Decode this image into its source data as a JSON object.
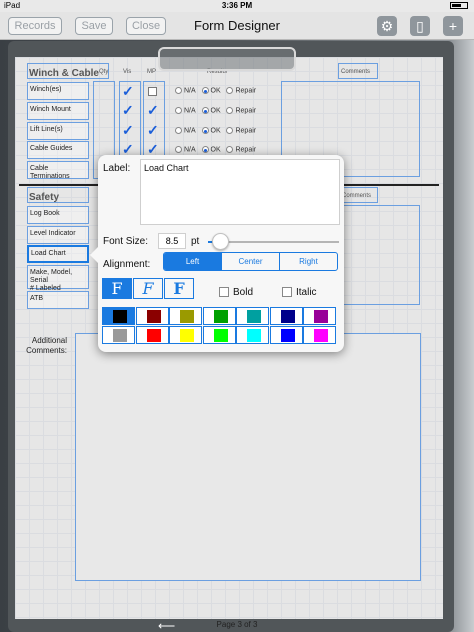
{
  "status_bar": {
    "device": "iPad",
    "time": "3:36 PM"
  },
  "toolbar": {
    "records_label": "Records",
    "save_label": "Save",
    "close_label": "Close",
    "title": "Form Designer"
  },
  "form": {
    "section1_title": "Winch & Cable",
    "col_headers": [
      "Qty",
      "Vis",
      "MP",
      "Results",
      "Comments"
    ],
    "rows": [
      {
        "label": "Winch(es)",
        "vis": true,
        "mp": false,
        "result": "OK"
      },
      {
        "label": "Winch Mount",
        "vis": true,
        "mp": true,
        "result": "OK"
      },
      {
        "label": "Lift Line(s)",
        "vis": true,
        "mp": true,
        "result": "OK"
      },
      {
        "label": "Cable Guides",
        "vis": true,
        "mp": true,
        "result": "OK"
      },
      {
        "label": "Cable Terminations",
        "vis": true,
        "mp": false,
        "result": ""
      }
    ],
    "radio_labels": [
      "N/A",
      "OK",
      "Repair"
    ],
    "section2_title": "Safety",
    "section2_comments_header": "Comments",
    "safety_rows": [
      "Log Book",
      "Level Indicator",
      "Load Chart",
      "Make, Model, Serial\n# Labeled",
      "ATB"
    ],
    "additional_comments_label": "Additional\nComments:"
  },
  "footer": {
    "page_indicator": "Page 3 of 3"
  },
  "popover": {
    "label_caption": "Label:",
    "label_value": "Load Chart",
    "font_size_caption": "Font Size:",
    "font_size_value": "8.5",
    "font_size_unit": "pt",
    "font_size_slider_fraction": 0.05,
    "alignment_caption": "Alignment:",
    "alignment_options": [
      "Left",
      "Center",
      "Right"
    ],
    "alignment_selected": "Left",
    "font_glyph": "F",
    "bold_label": "Bold",
    "italic_label": "Italic",
    "bold_checked": false,
    "italic_checked": false,
    "colors_row1": [
      "#000000",
      "#8b0000",
      "#9a9a00",
      "#00a000",
      "#00a0a0",
      "#00008b",
      "#990099"
    ],
    "colors_row2": [
      "#9a9a9a",
      "#ff0000",
      "#ffff00",
      "#00ff00",
      "#00ffff",
      "#0000ff",
      "#ff00ff"
    ],
    "selected_color": "#000000"
  }
}
